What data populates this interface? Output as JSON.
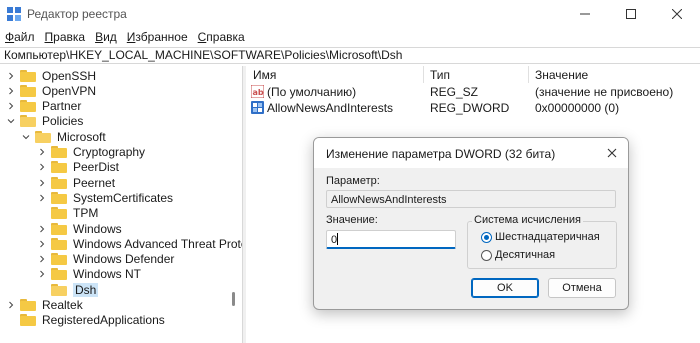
{
  "window": {
    "title": "Редактор реестра"
  },
  "menu": [
    {
      "underline": "Ф",
      "rest": "айл"
    },
    {
      "underline": "П",
      "rest": "равка"
    },
    {
      "underline": "В",
      "rest": "ид"
    },
    {
      "underline": "И",
      "rest": "збранное"
    },
    {
      "underline": "С",
      "rest": "правка"
    }
  ],
  "address": "Компьютер\\HKEY_LOCAL_MACHINE\\SOFTWARE\\Policies\\Microsoft\\Dsh",
  "tree": [
    {
      "label": "OpenSSH",
      "level": 1,
      "chev": "right"
    },
    {
      "label": "OpenVPN",
      "level": 1,
      "chev": "right"
    },
    {
      "label": "Partner",
      "level": 1,
      "chev": "right"
    },
    {
      "label": "Policies",
      "level": 1,
      "chev": "down"
    },
    {
      "label": "Microsoft",
      "level": 2,
      "chev": "down"
    },
    {
      "label": "Cryptography",
      "level": 3,
      "chev": "right"
    },
    {
      "label": "PeerDist",
      "level": 3,
      "chev": "right"
    },
    {
      "label": "Peernet",
      "level": 3,
      "chev": "right"
    },
    {
      "label": "SystemCertificates",
      "level": 3,
      "chev": "right"
    },
    {
      "label": "TPM",
      "level": 3,
      "chev": "none"
    },
    {
      "label": "Windows",
      "level": 3,
      "chev": "right"
    },
    {
      "label": "Windows Advanced Threat Protect",
      "level": 3,
      "chev": "right"
    },
    {
      "label": "Windows Defender",
      "level": 3,
      "chev": "right"
    },
    {
      "label": "Windows NT",
      "level": 3,
      "chev": "right"
    },
    {
      "label": "Dsh",
      "level": 3,
      "chev": "none",
      "selected": true
    },
    {
      "label": "Realtek",
      "level": 1,
      "chev": "right"
    },
    {
      "label": "RegisteredApplications",
      "level": 1,
      "chev": "none"
    }
  ],
  "list": {
    "headers": {
      "name": "Имя",
      "type": "Тип",
      "value": "Значение"
    },
    "rows": [
      {
        "name": "(По умолчанию)",
        "type": "REG_SZ",
        "value": "(значение не присвоено)",
        "icon": "string-value-icon"
      },
      {
        "name": "AllowNewsAndInterests",
        "type": "REG_DWORD",
        "value": "0x00000000 (0)",
        "icon": "dword-value-icon"
      }
    ]
  },
  "dialog": {
    "title": "Изменение параметра DWORD (32 бита)",
    "param_label": "Параметр:",
    "param_value": "AllowNewsAndInterests",
    "value_label": "Значение:",
    "value": "0",
    "base_group_title": "Система исчисления",
    "radio_hex": "Шестнадцатеричная",
    "radio_dec": "Десятичная",
    "selected_base": "hex",
    "ok_label": "OK",
    "cancel_label": "Отмена"
  },
  "colors": {
    "accent": "#0067c0",
    "folder": "#f5c944",
    "selection": "#cce4f7"
  }
}
